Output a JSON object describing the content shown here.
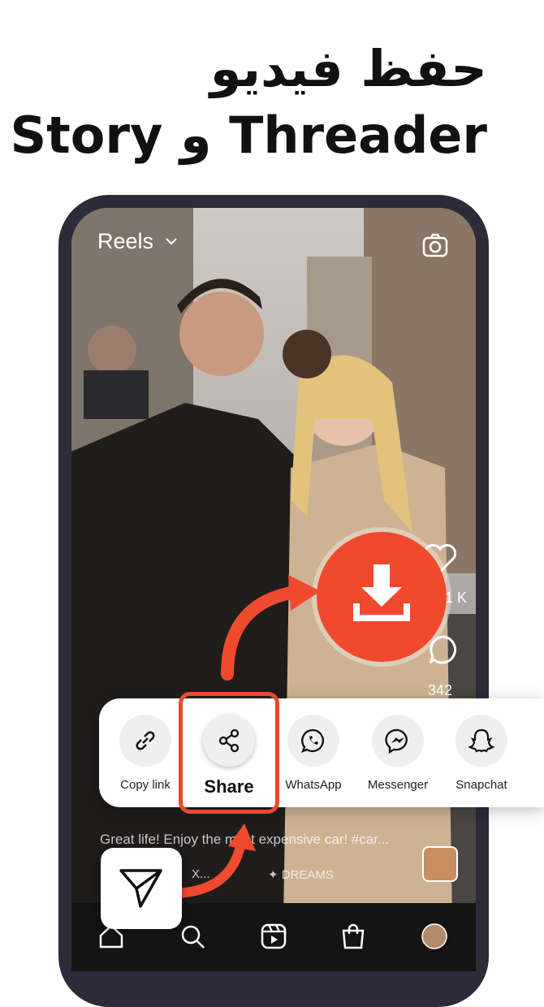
{
  "headline": {
    "line1": "حفظ فيديو",
    "line2": "Story و Threader"
  },
  "app": {
    "title": "Reels",
    "likes_count": "1 K",
    "comments_count": "342",
    "caption": "Great life! Enjoy the most expensive car! #car...",
    "music": "X...",
    "audio_tag": "✦ DREAMS"
  },
  "share_sheet": {
    "items": [
      {
        "label": "Copy link",
        "icon": "link-icon"
      },
      {
        "label": "Share",
        "icon": "share-icon"
      },
      {
        "label": "WhatsApp",
        "icon": "whatsapp-icon"
      },
      {
        "label": "Messenger",
        "icon": "messenger-icon"
      },
      {
        "label": "Snapchat",
        "icon": "snapchat-icon"
      }
    ]
  },
  "colors": {
    "accent": "#f04a2e",
    "highlight": "#e94a2f",
    "phone_frame": "#2d2b3a"
  },
  "nav": {
    "items": [
      "home-icon",
      "search-icon",
      "reels-icon",
      "shop-icon",
      "profile-avatar"
    ]
  }
}
